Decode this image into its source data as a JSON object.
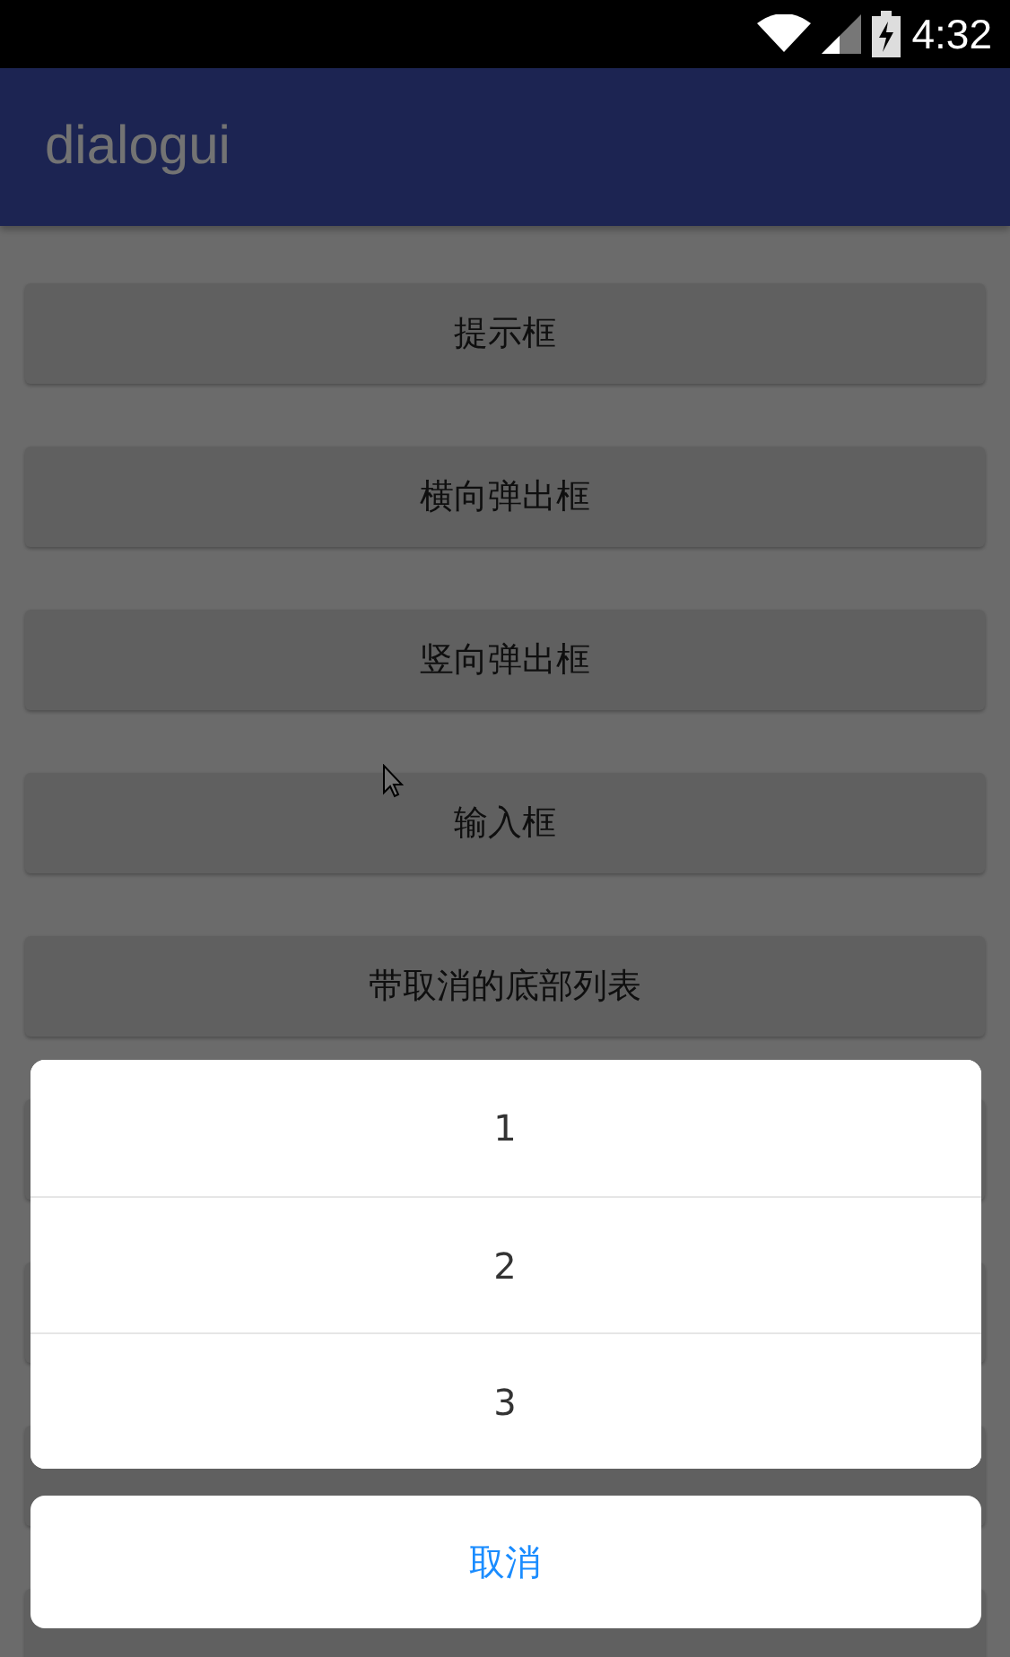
{
  "status_bar": {
    "time": "4:32"
  },
  "app_bar": {
    "title": "dialogui"
  },
  "buttons": [
    {
      "label": "提示框"
    },
    {
      "label": "横向弹出框"
    },
    {
      "label": "竖向弹出框"
    },
    {
      "label": "输入框"
    },
    {
      "label": "带取消的底部列表"
    }
  ],
  "bottom_sheet": {
    "items": [
      "1",
      "2",
      "3"
    ],
    "cancel": "取消"
  }
}
